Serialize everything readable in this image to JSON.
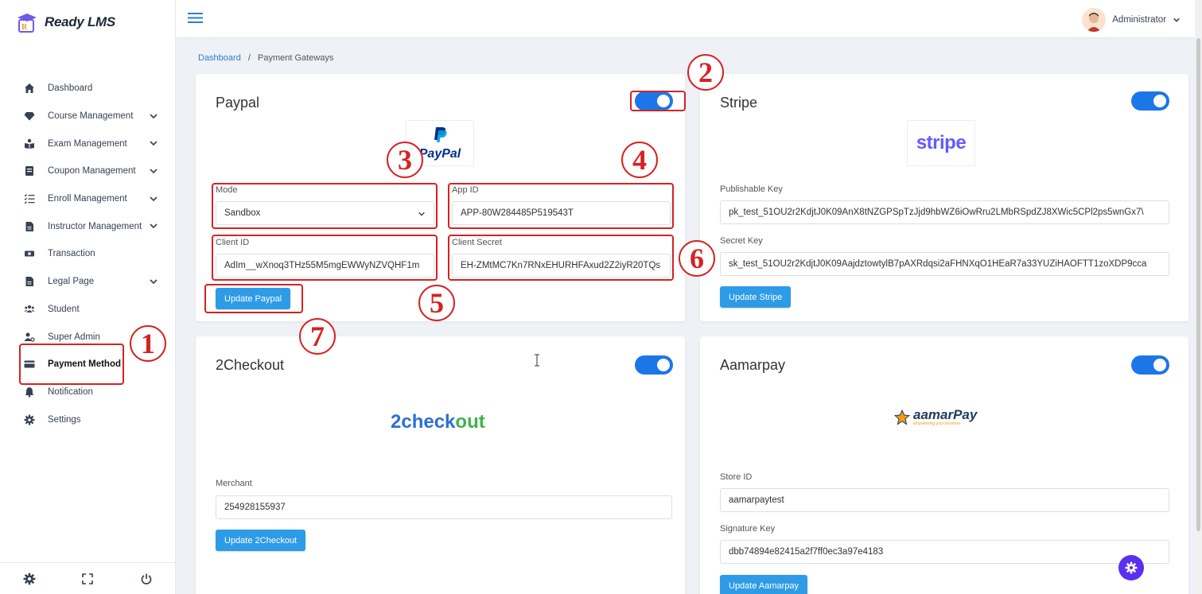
{
  "app": {
    "logo_text": "Ready LMS"
  },
  "sidebar": {
    "items": [
      {
        "label": "Dashboard",
        "icon": "home-icon",
        "chevron": false
      },
      {
        "label": "Course Management",
        "icon": "diamond-icon",
        "chevron": true
      },
      {
        "label": "Exam Management",
        "icon": "exam-icon",
        "chevron": true
      },
      {
        "label": "Coupon Management",
        "icon": "coupon-icon",
        "chevron": true
      },
      {
        "label": "Enroll Management",
        "icon": "list-check-icon",
        "chevron": true
      },
      {
        "label": "Instructor Management",
        "icon": "file-icon",
        "chevron": true
      },
      {
        "label": "Transaction",
        "icon": "money-icon",
        "chevron": false
      },
      {
        "label": "Legal Page",
        "icon": "file-icon",
        "chevron": true
      },
      {
        "label": "Student",
        "icon": "users-icon",
        "chevron": false
      },
      {
        "label": "Super Admin",
        "icon": "user-gear-icon",
        "chevron": false
      },
      {
        "label": "Payment Method",
        "icon": "credit-card-icon",
        "chevron": false,
        "active": true
      },
      {
        "label": "Notification",
        "icon": "bell-icon",
        "chevron": false
      },
      {
        "label": "Settings",
        "icon": "gear-icon",
        "chevron": false
      }
    ]
  },
  "topbar": {
    "user_name": "Administrator"
  },
  "breadcrumb": {
    "home": "Dashboard",
    "separator": "/",
    "current": "Payment Gateways"
  },
  "paypal": {
    "title": "Paypal",
    "enabled": true,
    "logo_text": "PayPal",
    "mode_label": "Mode",
    "mode_value": "Sandbox",
    "app_id_label": "App ID",
    "app_id_value": "APP-80W284485P519543T",
    "client_id_label": "Client ID",
    "client_id_value": "AdIm__wXnoq3THz55M5mgEWWyNZVQHF1m",
    "client_secret_label": "Client Secret",
    "client_secret_value": "EH-ZMtMC7Kn7RNxEHURHFAxud2Z2iyR20TQs",
    "button": "Update Paypal"
  },
  "stripe": {
    "title": "Stripe",
    "enabled": true,
    "logo_text": "stripe",
    "publishable_label": "Publishable Key",
    "publishable_value": "pk_test_51OU2r2KdjtJ0K09AnX8tNZGPSpTzJjd9hbWZ6iOwRru2LMbRSpdZJ8XWic5CPl2ps5wnGx7\\",
    "secret_label": "Secret Key",
    "secret_value": "sk_test_51OU2r2KdjtJ0K09AajdztowtylB7pAXRdqsi2aFHNXqO1HEaR7a33YUZiHAOFTT1zoXDP9cca",
    "button": "Update Stripe"
  },
  "twocheckout": {
    "title": "2Checkout",
    "enabled": true,
    "logo_text_a": "2check",
    "logo_text_b": "out",
    "merchant_label": "Merchant",
    "merchant_value": "254928155937",
    "button": "Update 2Checkout"
  },
  "aamarpay": {
    "title": "Aamarpay",
    "enabled": true,
    "logo_text": "aamarPay",
    "logo_tagline": "empowering your business",
    "store_label": "Store ID",
    "store_value": "aamarpaytest",
    "signature_label": "Signature Key",
    "signature_value": "dbb74894e82415a2f7ff0ec3a97e4183",
    "button": "Update Aamarpay"
  },
  "annotations": [
    "1",
    "2",
    "3",
    "4",
    "5",
    "6",
    "7"
  ],
  "colors": {
    "accent": "#1d76e8",
    "button": "#2e9be6",
    "annotation": "#d62222",
    "fab": "#5b2ef0"
  }
}
